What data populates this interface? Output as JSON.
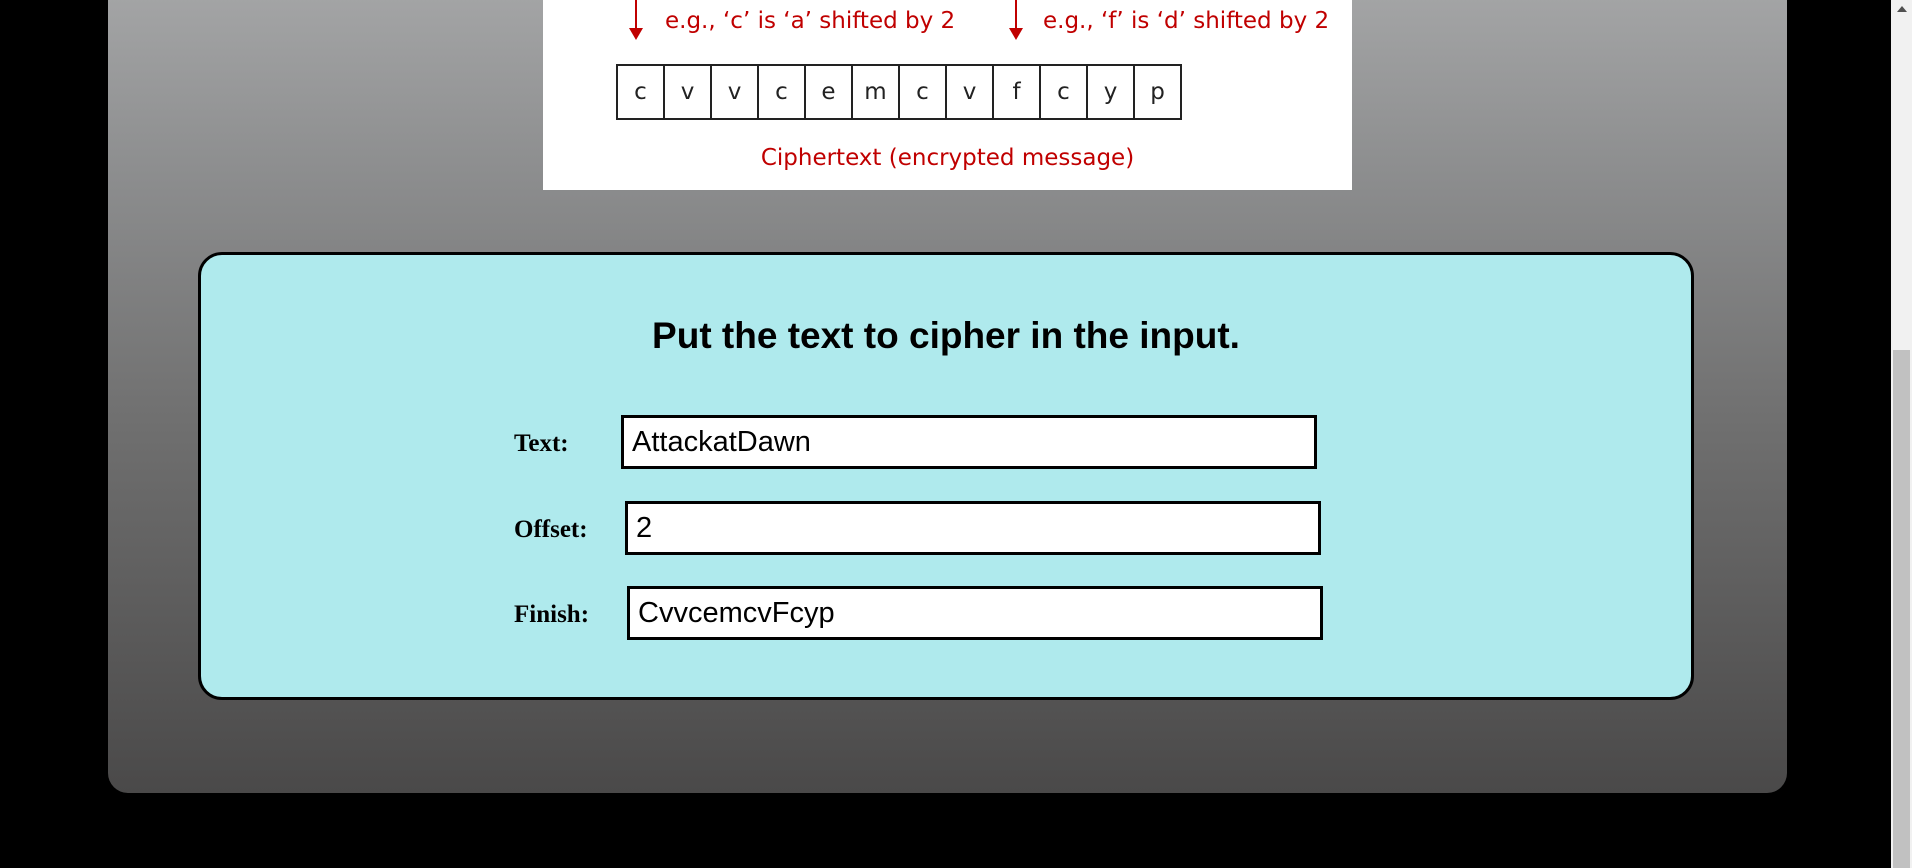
{
  "diagram": {
    "example_left": "e.g., ‘c’  is ‘a’ shifted by 2",
    "example_right": "e.g., ‘f’  is ‘d’ shifted by 2",
    "cipher_cells": [
      "c",
      "v",
      "v",
      "c",
      "e",
      "m",
      "c",
      "v",
      "f",
      "c",
      "y",
      "p"
    ],
    "caption": "Ciphertext (encrypted message)",
    "accent_color": "#c00000"
  },
  "form": {
    "heading": "Put the text to cipher in the input.",
    "text_label": "Text:",
    "text_value": "AttackatDawn",
    "offset_label": "Offset:",
    "offset_value": "2",
    "finish_label": "Finish:",
    "finish_value": "CvvcemcvFcyp",
    "background_color": "#afeaed"
  }
}
